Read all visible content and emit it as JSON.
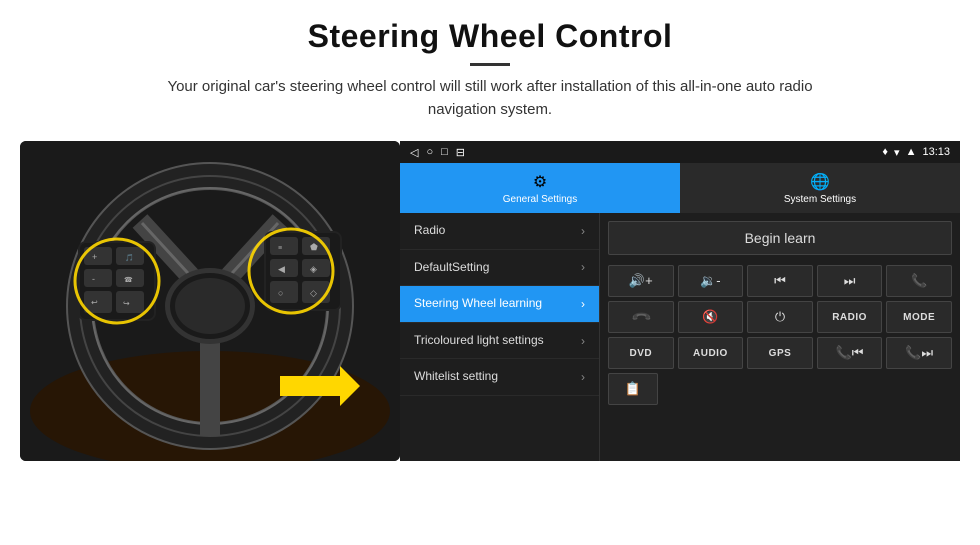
{
  "header": {
    "title": "Steering Wheel Control",
    "subtitle": "Your original car's steering wheel control will still work after installation of this all-in-one auto radio navigation system."
  },
  "statusBar": {
    "back_icon": "◁",
    "home_icon": "○",
    "recent_icon": "□",
    "screenshot_icon": "⊟",
    "location_icon": "♦",
    "wifi_icon": "▾",
    "signal_icon": "▲",
    "time": "13:13"
  },
  "tabs": [
    {
      "id": "general",
      "label": "General Settings",
      "active": true
    },
    {
      "id": "system",
      "label": "System Settings",
      "active": false
    }
  ],
  "menu": [
    {
      "id": "radio",
      "label": "Radio",
      "active": false
    },
    {
      "id": "default",
      "label": "DefaultSetting",
      "active": false
    },
    {
      "id": "steering",
      "label": "Steering Wheel learning",
      "active": true
    },
    {
      "id": "tricoloured",
      "label": "Tricoloured light settings",
      "active": false
    },
    {
      "id": "whitelist",
      "label": "Whitelist setting",
      "active": false
    }
  ],
  "panel": {
    "begin_learn": "Begin learn",
    "controls": [
      [
        "vol+",
        "vol-",
        "prev",
        "next",
        "phone"
      ],
      [
        "hang",
        "mute",
        "power",
        "RADIO",
        "MODE"
      ],
      [
        "DVD",
        "AUDIO",
        "GPS",
        "vol_prev",
        "vol_next"
      ]
    ],
    "icons": {
      "vol_up": "🔊+",
      "vol_down": "🔉-",
      "prev": "⏮",
      "next": "⏭",
      "phone": "📞",
      "hang": "📞",
      "mute": "🔇",
      "power": "⏻",
      "whitelist_icon": "📋"
    }
  }
}
